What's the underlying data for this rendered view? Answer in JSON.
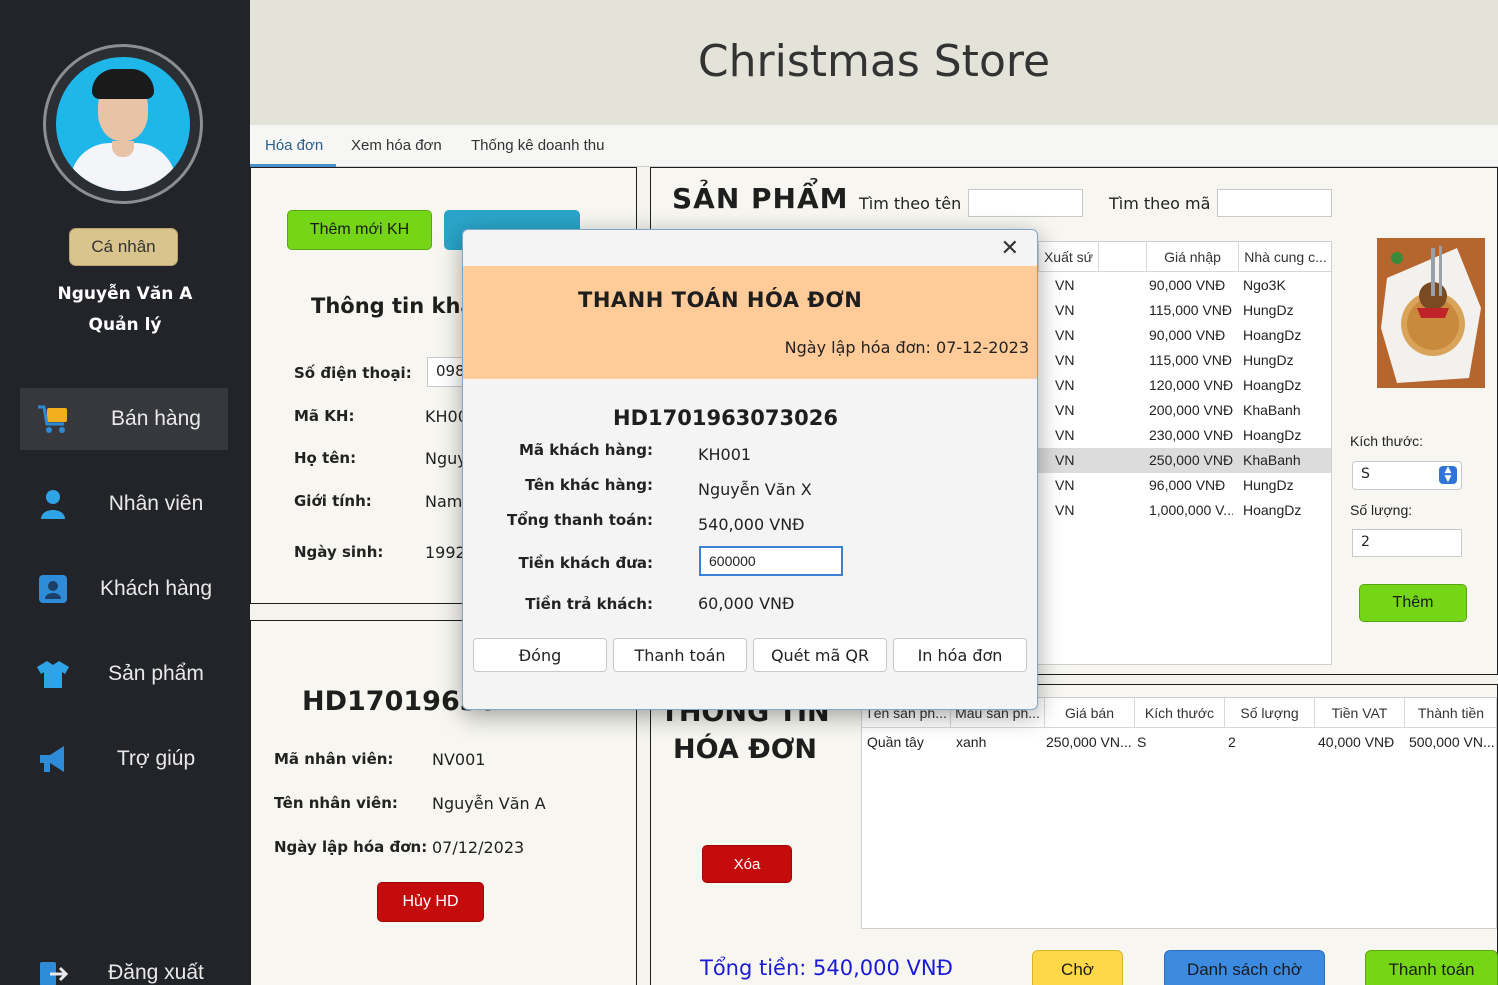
{
  "app": {
    "title": "Christmas Store"
  },
  "sidebar": {
    "profile_button": "Cá nhân",
    "user_name": "Nguyễn Văn A",
    "user_role": "Quản lý",
    "items": [
      {
        "label": "Bán hàng",
        "icon": "cart-icon"
      },
      {
        "label": "Nhân viên",
        "icon": "person-icon"
      },
      {
        "label": "Khách hàng",
        "icon": "contact-card-icon"
      },
      {
        "label": "Sản phẩm",
        "icon": "shirt-icon"
      },
      {
        "label": "Trợ giúp",
        "icon": "megaphone-icon"
      },
      {
        "label": "Đăng xuất",
        "icon": "logout-icon"
      }
    ]
  },
  "tabs": [
    "Hóa đơn",
    "Xem hóa đơn",
    "Thống kê doanh thu"
  ],
  "customer": {
    "add_button": "Thêm mới KH",
    "heading": "Thông tin khá",
    "phone_label": "Số điện thoại:",
    "phone_value": "098",
    "id_label": "Mã KH:",
    "id_value": "KH00",
    "name_label": "Họ tên:",
    "name_value": "Nguy",
    "gender_label": "Giới tính:",
    "gender_value": "Nam",
    "dob_label": "Ngày sinh:",
    "dob_value": "1992"
  },
  "invoice_left": {
    "number": "HD17019630",
    "employee_id_label": "Mã nhân viên:",
    "employee_id": "NV001",
    "employee_name_label": "Tên nhân viên:",
    "employee_name": "Nguyễn Văn A",
    "date_label": "Ngày lập hóa đơn:",
    "date": "07/12/2023",
    "cancel_button": "Hủy HD"
  },
  "products": {
    "heading": "SẢN PHẨM",
    "search_name_label": "Tìm theo tên",
    "search_code_label": "Tìm theo mã",
    "columns": [
      "Xuất sứ",
      "Giá nhập",
      "Nhà cung c..."
    ],
    "rows": [
      {
        "origin": "VN",
        "price": "90,000 VNĐ",
        "supplier": "Ngo3K"
      },
      {
        "origin": "VN",
        "price": "115,000 VNĐ",
        "supplier": "HungDz"
      },
      {
        "origin": "VN",
        "price": "90,000 VNĐ",
        "supplier": "HoangDz"
      },
      {
        "origin": "VN",
        "price": "115,000 VNĐ",
        "supplier": "HungDz"
      },
      {
        "origin": "VN",
        "price": "120,000 VNĐ",
        "supplier": "HoangDz"
      },
      {
        "origin": "VN",
        "price": "200,000 VNĐ",
        "supplier": "KhaBanh"
      },
      {
        "origin": "VN",
        "price": "230,000 VNĐ",
        "supplier": "HoangDz"
      },
      {
        "origin": "VN",
        "price": "250,000 VNĐ",
        "supplier": "KhaBanh"
      },
      {
        "origin": "VN",
        "price": "96,000 VNĐ",
        "supplier": "HungDz"
      },
      {
        "origin": "VN",
        "price": "1,000,000 V...",
        "supplier": "HoangDz"
      }
    ],
    "selected_row": 7,
    "size_label": "Kích thước:",
    "size_value": "S",
    "quantity_label": "Số lượng:",
    "quantity_value": "2",
    "add_button": "Thêm"
  },
  "invoice_detail": {
    "heading_line1": "THÔNG TIN",
    "heading_line2": "HÓA ĐƠN",
    "delete_button": "Xóa",
    "columns": [
      "Tên sản ph...",
      "Màu sản ph...",
      "Giá bán",
      "Kích thước",
      "Số lượng",
      "Tiền VAT",
      "Thành tiền"
    ],
    "row": [
      "Quần tây",
      "xanh",
      "250,000 VN...",
      "S",
      "2",
      "40,000 VNĐ",
      "500,000 VN..."
    ],
    "total": "Tổng tiền: 540,000 VNĐ",
    "wait_button": "Chờ",
    "wait_list_button": "Danh sách chờ",
    "pay_button": "Thanh toán"
  },
  "dialog": {
    "title": "THANH TOÁN HÓA ĐƠN",
    "date": "Ngày lập hóa đơn: 07-12-2023",
    "invoice_number": "HD1701963073026",
    "customer_id_label": "Mã khách hàng:",
    "customer_id": "KH001",
    "customer_name_label": "Tên khác hàng:",
    "customer_name": "Nguyễn Văn X",
    "total_label": "Tổng thanh toán:",
    "total": "540,000 VNĐ",
    "given_label": "Tiền khách đưa:",
    "given": "600000",
    "change_label": "Tiền trả khách:",
    "change": "60,000 VNĐ",
    "buttons": [
      "Đóng",
      "Thanh toán",
      "Quét mã QR",
      "In hóa đơn"
    ]
  },
  "colors": {
    "sidebar_bg": "#222429",
    "header_bg": "#e4e3d9",
    "accent_green": "#74d616",
    "danger_red": "#c40c0c",
    "dialog_banner": "#ffcb98",
    "total_blue": "#1a1ad6"
  }
}
